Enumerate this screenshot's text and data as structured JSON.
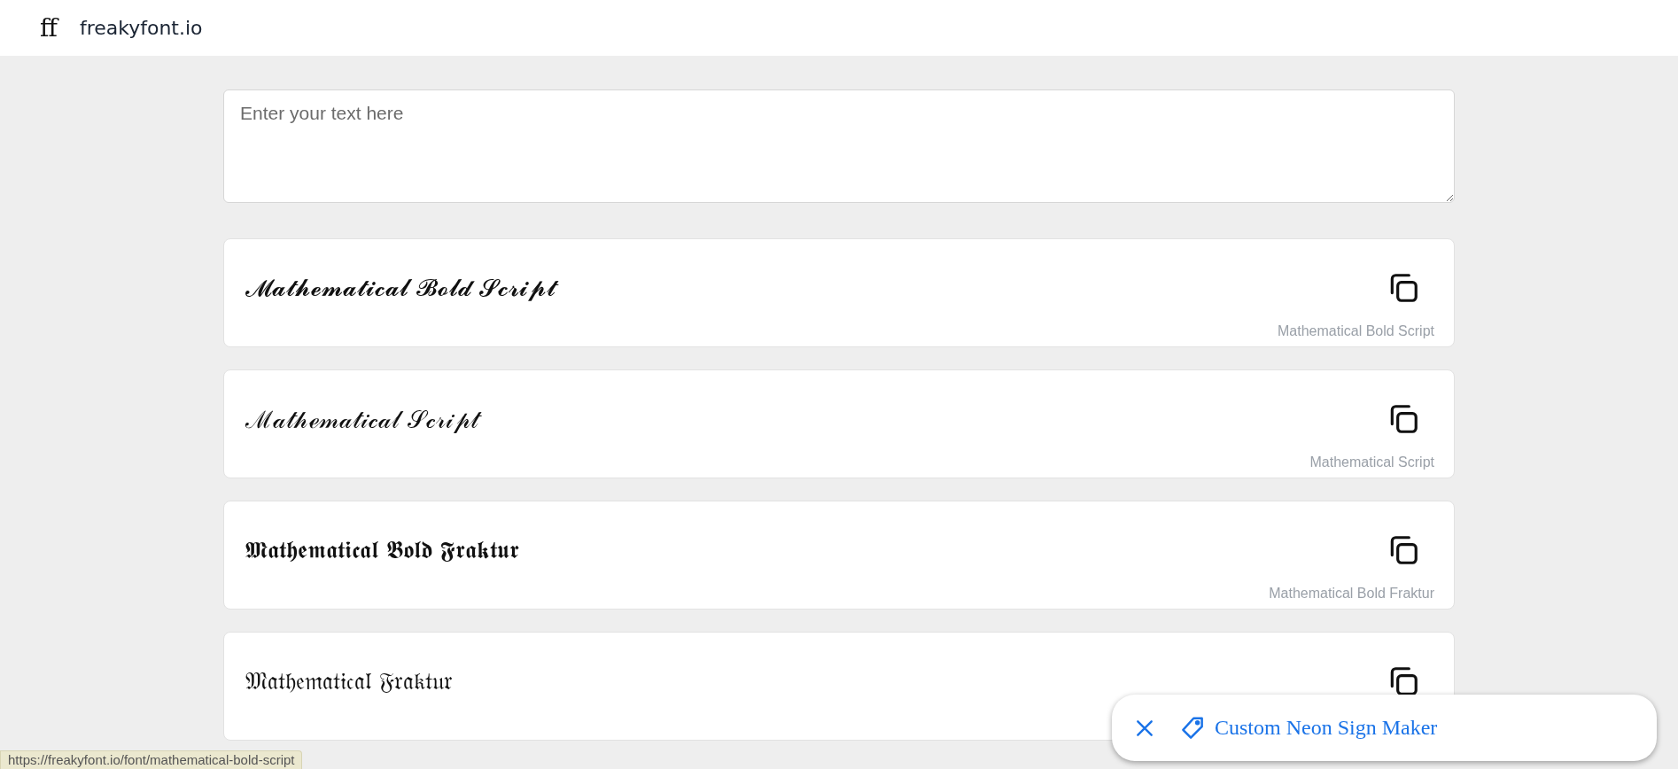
{
  "header": {
    "logo": "ff",
    "site_name": "freakyfont.io"
  },
  "text_input": {
    "placeholder": "Enter your text here"
  },
  "font_cards": [
    {
      "preview": "𝓜𝓪𝓽𝓱𝓮𝓶𝓪𝓽𝓲𝓬𝓪𝓵 𝓑𝓸𝓵𝓭 𝓢𝓬𝓻𝓲𝓹𝓽",
      "label": "Mathematical Bold Script"
    },
    {
      "preview": "ℳ𝒶𝓉𝒽ℯ𝓂𝒶𝓉𝒾𝒸𝒶𝓁 𝒮𝒸𝓇𝒾𝓅𝓉",
      "label": "Mathematical Script"
    },
    {
      "preview": "𝕸𝖆𝖙𝖍𝖊𝖒𝖆𝖙𝖎𝖈𝖆𝖑 𝕭𝖔𝖑𝖉 𝕱𝖗𝖆𝖐𝖙𝖚𝖗",
      "label": "Mathematical Bold Fraktur"
    },
    {
      "preview": "𝔐𝔞𝔱𝔥𝔢𝔪𝔞𝔱𝔦𝔠𝔞𝔩 𝔉𝔯𝔞𝔨𝔱𝔲𝔯"
    }
  ],
  "promo_popup": {
    "link": "Custom Neon Sign Maker"
  },
  "status_bar": {
    "url": "https://freakyfont.io/font/mathematical-bold-script"
  }
}
